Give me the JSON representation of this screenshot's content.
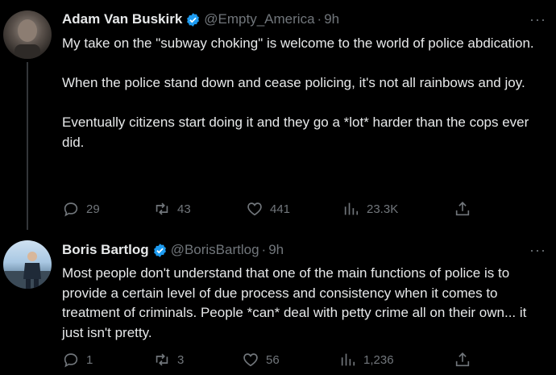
{
  "tweets": [
    {
      "name": "Adam Van Buskirk",
      "handle": "@Empty_America",
      "separator": "·",
      "time": "9h",
      "more": "···",
      "paragraphs": [
        "My take on the \"subway choking\" is welcome to the world of police abdication.",
        "When the police stand down and cease policing, it's not all rainbows and joy.",
        "Eventually citizens start doing it and they go a *lot* harder than the cops ever did."
      ],
      "replies": "29",
      "retweets": "43",
      "likes": "441",
      "views": "23.3K"
    },
    {
      "name": "Boris Bartlog",
      "handle": "@BorisBartlog",
      "separator": "·",
      "time": "9h",
      "more": "···",
      "paragraphs": [
        "Most people don't understand that one of the main functions of police is to provide a certain level of due process and consistency when it comes to treatment of criminals. People *can* deal with petty crime all on their own... it just isn't pretty."
      ],
      "replies": "1",
      "retweets": "3",
      "likes": "56",
      "views": "1,236"
    }
  ],
  "colors": {
    "background": "#000000",
    "text": "#e7e9ea",
    "secondary": "#71767b",
    "verified": "#1d9bf0"
  },
  "icons": [
    "reply-icon",
    "retweet-icon",
    "like-icon",
    "views-icon",
    "share-icon",
    "verified-badge-icon",
    "more-icon"
  ]
}
